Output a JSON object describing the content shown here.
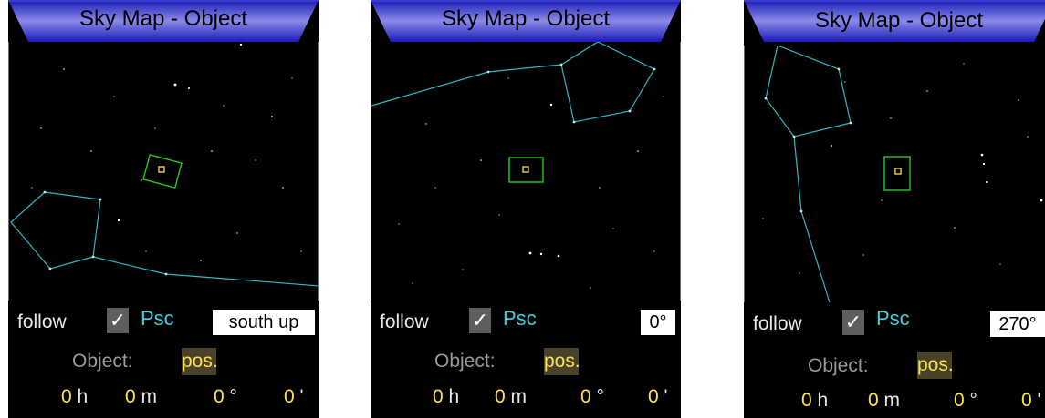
{
  "panels": [
    {
      "title": "Sky Map - Object",
      "follow_label": "follow",
      "follow_checked": "✓",
      "constellation": "Psc",
      "rotation": "south up",
      "object_label": "Object:",
      "pos_button": "pos.",
      "ra_h": "0",
      "ra_h_unit": "h",
      "ra_m": "0",
      "ra_m_unit": "m",
      "dec_deg": "0",
      "dec_deg_unit": "°",
      "dec_min": "0",
      "dec_min_unit": "'"
    },
    {
      "title": "Sky Map - Object",
      "follow_label": "follow",
      "follow_checked": "✓",
      "constellation": "Psc",
      "rotation": "0°",
      "object_label": "Object:",
      "pos_button": "pos.",
      "ra_h": "0",
      "ra_h_unit": "h",
      "ra_m": "0",
      "ra_m_unit": "m",
      "dec_deg": "0",
      "dec_deg_unit": "°",
      "dec_min": "0",
      "dec_min_unit": "'"
    },
    {
      "title": "Sky Map - Object",
      "follow_label": "follow",
      "follow_checked": "✓",
      "constellation": "Psc",
      "rotation": "270°",
      "object_label": "Object:",
      "pos_button": "pos.",
      "ra_h": "0",
      "ra_h_unit": "h",
      "ra_m": "0",
      "ra_m_unit": "m",
      "dec_deg": "0",
      "dec_deg_unit": "°",
      "dec_min": "0",
      "dec_min_unit": "'"
    }
  ],
  "colors": {
    "constellation_lines": "#2fb8c4",
    "field_frame": "#22cc22",
    "object_marker": "#ffe14a",
    "titlebar": "#3a3ad0"
  }
}
